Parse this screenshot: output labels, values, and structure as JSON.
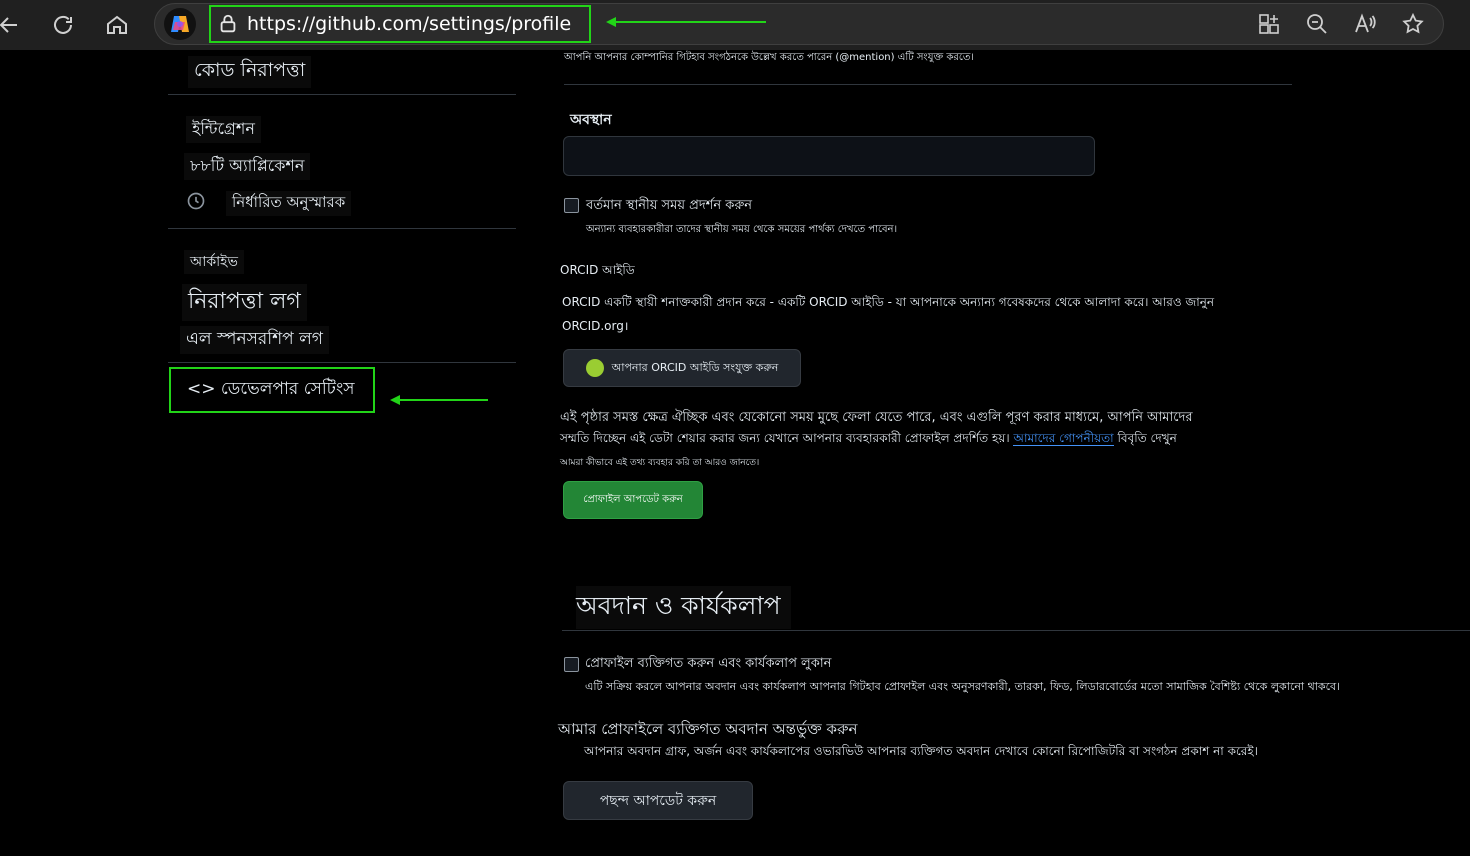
{
  "browser": {
    "url": "https://github.com/settings/profile",
    "toolbar_icons": [
      "back-icon",
      "refresh-icon",
      "home-icon",
      "copilot-icon",
      "lock-icon",
      "split-screen-icon",
      "zoom-out-icon",
      "read-aloud-icon",
      "favorite-icon"
    ]
  },
  "sidebar": {
    "code_security": "কোড নিরাপত্তা",
    "integrations": "ইন্টিগ্রেশন",
    "applications": "৮৮টি অ্যাপ্লিকেশন",
    "scheduled_reminders": "নির্ধারিত অনুস্মারক",
    "archives": "আর্কাইভ",
    "security_log": "নিরাপত্তা লগ",
    "sponsorship_log": "এল স্পনসরশিপ লগ",
    "developer_settings": "<> ডেভেলপার সেটিংস"
  },
  "main": {
    "mention_note": "আপনি আপনার কোম্পানির গিটহাব সংগঠনকে উল্লেখ করতে পারেন (@mention) এটি সংযুক্ত করতে।",
    "location_label": "অবস্থান",
    "location_value": "",
    "local_time_label": "বর্তমান স্থানীয় সময় প্রদর্শন করুন",
    "local_time_note": "অন্যান্য ব্যবহারকারীরা তাদের স্থানীয় সময় থেকে সময়ের পার্থক্য দেখতে পাবেন।",
    "orcid_heading": "ORCID আইডি",
    "orcid_desc": "ORCID একটি স্থায়ী শনাক্তকারী প্রদান করে - একটি ORCID আইডি - যা আপনাকে অন্যান্য গবেষকদের থেকে আলাদা করে। আরও জানুন",
    "orcid_link": "ORCID.org।",
    "orcid_button": "আপনার ORCID আইডি সংযুক্ত করুন",
    "optional_line1": "এই পৃষ্ঠার সমস্ত ক্ষেত্র ঐচ্ছিক এবং যেকোনো সময় মুছে ফেলা যেতে পারে, এবং এগুলি পূরণ করার মাধ্যমে, আপনি আমাদের",
    "optional_line2": "সম্মতি দিচ্ছেন এই ডেটা শেয়ার করার জন্য যেখানে আপনার ব্যবহারকারী প্রোফাইল প্রদর্শিত হয়।",
    "privacy_link": "আমাদের গোপনীয়তা",
    "privacy_suffix": "বিবৃতি দেখুন",
    "data_use_note": "আমরা কীভাবে এই তথ্য ব্যবহার করি তা আরও জানতে।",
    "update_profile_button": "প্রোফাইল আপডেট করুন",
    "contributions_heading": "অবদান ও কার্যকলাপ",
    "private_profile_label": "প্রোফাইল ব্যক্তিগত করুন এবং কার্যকলাপ লুকান",
    "private_profile_note": "এটি সক্রিয় করলে আপনার অবদান এবং কার্যকলাপ আপনার গিটহাব প্রোফাইল এবং অনুসরণকারী, তারকা, ফিড, লিডারবোর্ডের মতো সামাজিক বৈশিষ্ট্য থেকে লুকানো থাকবে।",
    "include_private_label": "আমার প্রোফাইলে ব্যক্তিগত অবদান অন্তর্ভুক্ত করুন",
    "include_private_note": "আপনার অবদান গ্রাফ, অর্জন এবং কার্যকলাপের ওভারভিউ আপনার ব্যক্তিগত অবদান দেখাবে কোনো রিপোজিটরি বা সংগঠন প্রকাশ না করেই।",
    "update_prefs_button": "পছন্দ আপডেট করুন"
  },
  "colors": {
    "annotation_green": "#22d418",
    "button_green": "#238636",
    "link_blue": "#4493f8"
  }
}
